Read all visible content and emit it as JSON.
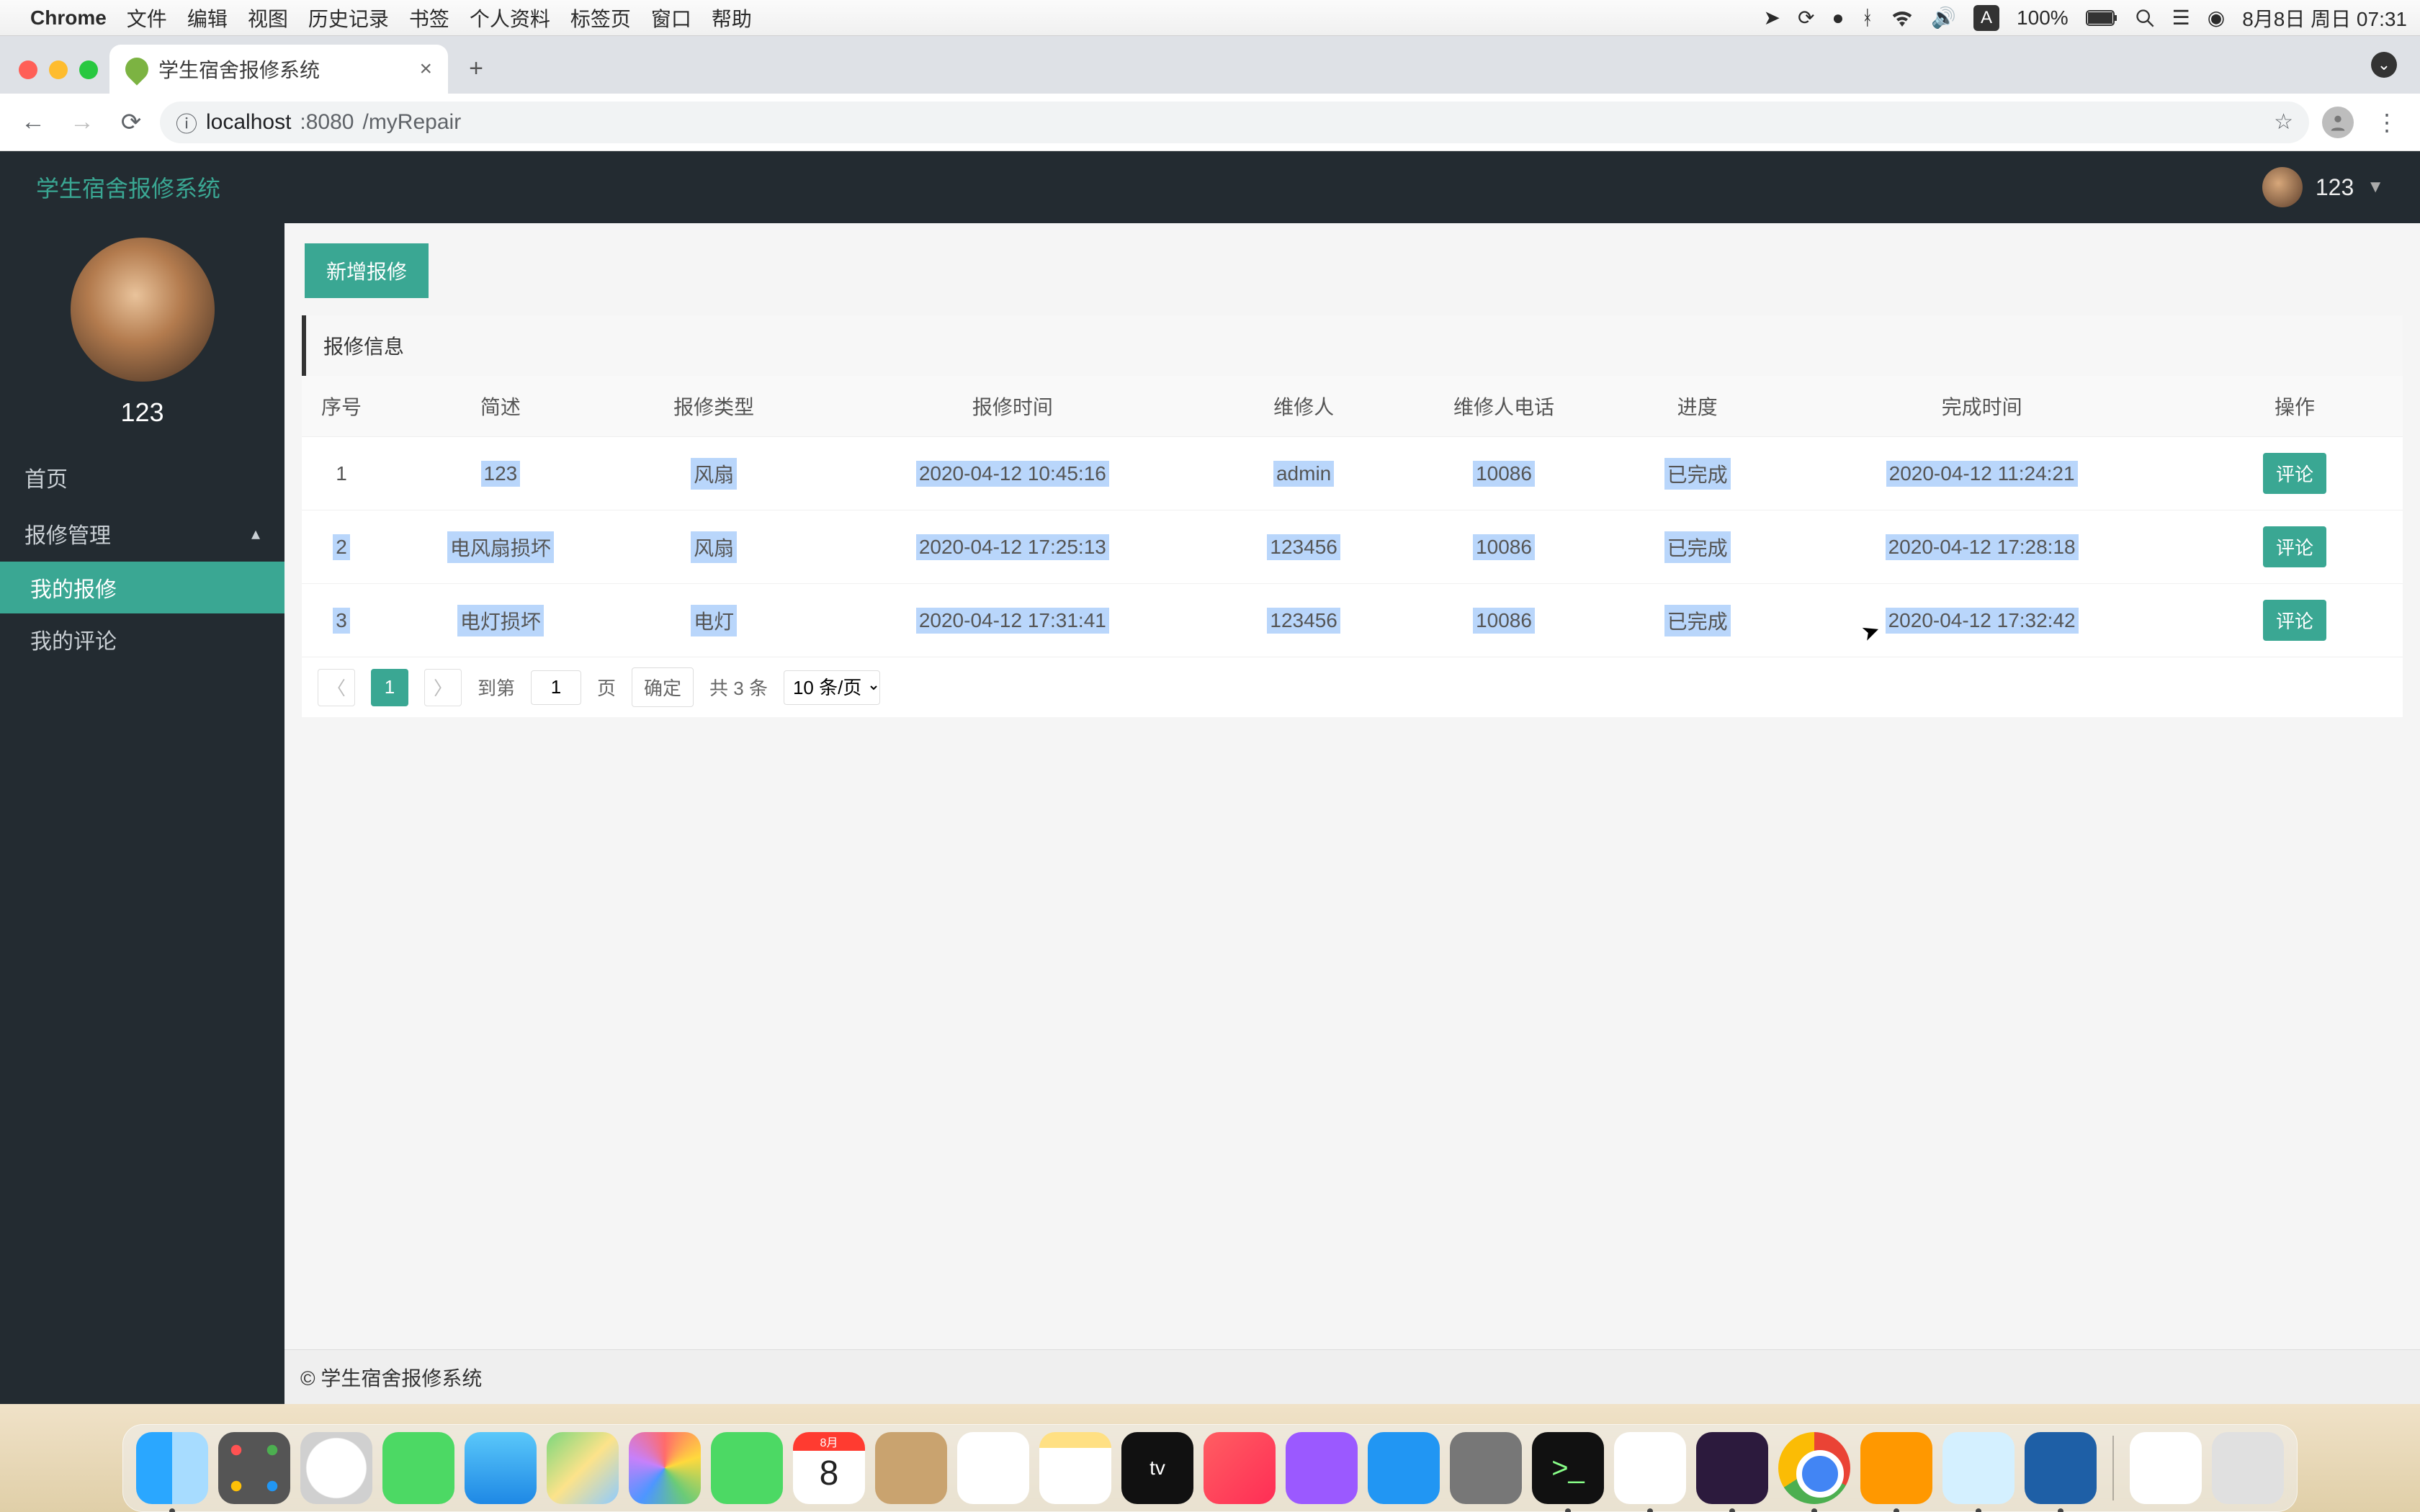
{
  "menubar": {
    "app": "Chrome",
    "items": [
      "文件",
      "编辑",
      "视图",
      "历史记录",
      "书签",
      "个人资料",
      "标签页",
      "窗口",
      "帮助"
    ],
    "battery": "100%",
    "input_mode": "A",
    "date": "8月8日 周日 07:31"
  },
  "browser": {
    "tab_title": "学生宿舍报修系统",
    "url_prefix": "localhost",
    "url_port": ":8080",
    "url_path": "/myRepair"
  },
  "app": {
    "title": "学生宿舍报修系统",
    "header_user": "123",
    "sidebar_user": "123",
    "sidebar": {
      "home": "首页",
      "group": "报修管理",
      "my_repair": "我的报修",
      "my_comment": "我的评论"
    },
    "buttons": {
      "create": "新增报修",
      "comment": "评论"
    },
    "card_title": "报修信息",
    "columns": [
      "序号",
      "简述",
      "报修类型",
      "报修时间",
      "维修人",
      "维修人电话",
      "进度",
      "完成时间",
      "操作"
    ],
    "rows": [
      {
        "idx": "1",
        "desc": "123",
        "type": "风扇",
        "time": "2020-04-12 10:45:16",
        "worker": "admin",
        "phone": "10086",
        "status": "已完成",
        "done": "2020-04-12 11:24:21"
      },
      {
        "idx": "2",
        "desc": "电风扇损坏",
        "type": "风扇",
        "time": "2020-04-12 17:25:13",
        "worker": "123456",
        "phone": "10086",
        "status": "已完成",
        "done": "2020-04-12 17:28:18"
      },
      {
        "idx": "3",
        "desc": "电灯损坏",
        "type": "电灯",
        "time": "2020-04-12 17:31:41",
        "worker": "123456",
        "phone": "10086",
        "status": "已完成",
        "done": "2020-04-12 17:32:42"
      }
    ],
    "pager": {
      "current": "1",
      "goto_label_pre": "到第",
      "goto_value": "1",
      "goto_label_post": "页",
      "confirm": "确定",
      "total": "共 3 条",
      "per_page": "10 条/页"
    },
    "footer": "© 学生宿舍报修系统"
  },
  "dock": {
    "cal_day": "8"
  }
}
